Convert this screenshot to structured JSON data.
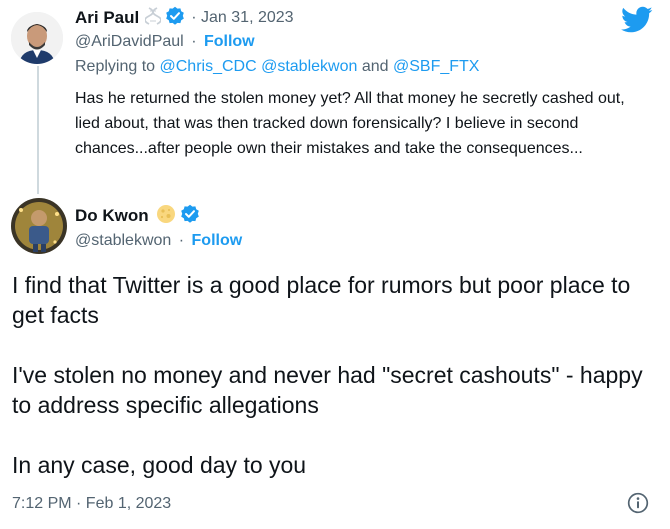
{
  "brand": {
    "icon": "twitter-bird-icon",
    "color": "#1d9bf0"
  },
  "reply_tweet": {
    "author_name": "Ari Paul",
    "author_badge_icon": "dna-emoji-icon",
    "verified_icon": "verified-badge-icon",
    "date": "· Jan 31, 2023",
    "handle": "@AriDavidPaul",
    "separator": "·",
    "follow_label": "Follow",
    "replying_to_prefix": "Replying to",
    "replying_to_1": "@Chris_CDC",
    "replying_to_2": "@stablekwon",
    "replying_to_and": "and",
    "replying_to_3": "@SBF_FTX",
    "text": "Has he returned the stolen money yet?  All that money he secretly cashed out, lied about, that was then tracked down forensically?  I believe in second chances...after people own their mistakes and take the consequences..."
  },
  "main_tweet": {
    "author_name": "Do Kwon",
    "author_badge_icon": "moon-emoji-icon",
    "verified_icon": "verified-badge-icon",
    "handle": "@stablekwon",
    "separator": "·",
    "follow_label": "Follow",
    "paragraphs": [
      "I find that Twitter is a good place for rumors but poor place to get facts",
      "I've stolen no money and never had \"secret cashouts\" - happy to address specific allegations",
      "In any case, good day to you"
    ],
    "timestamp": "7:12 PM · Feb 1, 2023",
    "info_icon": "info-icon"
  }
}
